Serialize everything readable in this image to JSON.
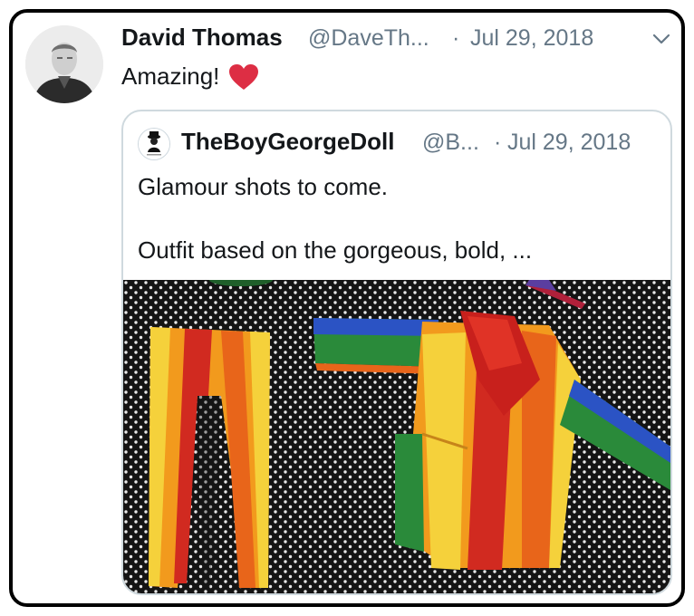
{
  "tweet": {
    "author_name": "David Thomas",
    "author_handle": "@DaveTh...",
    "separator": "·",
    "date": "Jul 29, 2018",
    "text": "Amazing!",
    "emoji": "red-heart-icon",
    "menu_icon": "chevron-down-icon"
  },
  "quoted_tweet": {
    "author_name": "TheBoyGeorgeDoll",
    "author_handle": "@B...",
    "separator": "·",
    "date": "Jul 29, 2018",
    "text_line1": "Glamour shots to come.",
    "text_line2": "Outfit based on the gorgeous, bold, ...",
    "image_subject": "rainbow-striped doll trousers and jacket on polka-dot fabric"
  },
  "colors": {
    "text": "#14171a",
    "secondary_text": "#657786",
    "quote_border": "#cfd9de",
    "heart": "#e0245e"
  }
}
